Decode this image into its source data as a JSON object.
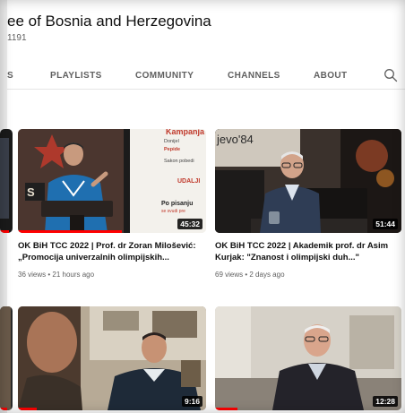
{
  "header": {
    "title": "ee of Bosnia and Herzegovina",
    "handle": "1191"
  },
  "tabs": [
    {
      "label": "S"
    },
    {
      "label": "PLAYLISTS"
    },
    {
      "label": "COMMUNITY"
    },
    {
      "label": "CHANNELS"
    },
    {
      "label": "ABOUT"
    }
  ],
  "search_icon": "search-icon",
  "videos": [
    {
      "title_line1": "OK BiH TCC 2022 | Prof. dr Zoran Milošević:",
      "title_line2": "„Promocija univerzalnih olimpijskih...",
      "meta": "36 views • 21 hours ago",
      "duration": "45:32",
      "thumb_text_top": "Kampanja",
      "thumb_lines": [
        "Donijel",
        "Pepide",
        "Sakon pobedi"
      ],
      "thumb_tag": "UDALJI",
      "thumb_bottom": "Po pisanju",
      "thumb_bottom2": "se svudi pre",
      "watched_fraction": 0.55
    },
    {
      "title_line1": "OK BiH TCC 2022 | Akademik prof. dr Asim",
      "title_line2": "Kurjak: \"Znanost i olimpijski duh...\"",
      "meta": "69 views • 2 days ago",
      "duration": "51:44",
      "thumb_text": "jevo'84",
      "watched_fraction": 0
    },
    {
      "duration": "9:16",
      "watched_fraction": 0.1
    },
    {
      "duration": "12:28",
      "watched_fraction": 0.12
    }
  ],
  "colors": {
    "accent_red": "#ff0000",
    "tab_text": "#606060"
  }
}
